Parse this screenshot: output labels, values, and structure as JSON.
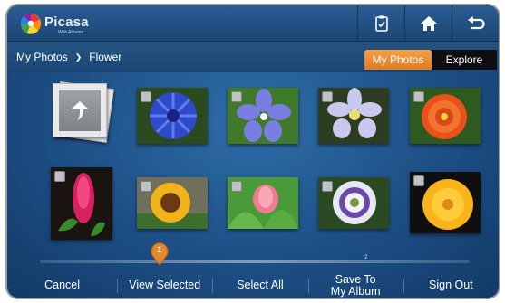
{
  "header": {
    "app_name": "Picasa",
    "app_subtitle": "Web Albums",
    "buttons": [
      {
        "icon": "clipboard-icon"
      },
      {
        "icon": "home-icon"
      },
      {
        "icon": "back-icon"
      }
    ]
  },
  "breadcrumb": {
    "root": "My Photos",
    "separator": "❯",
    "current": "Flower"
  },
  "tabs": {
    "my_photos": "My Photos",
    "explore": "Explore"
  },
  "photos": [
    {
      "subject": "blue cornflower",
      "selected": false
    },
    {
      "subject": "periwinkle flower",
      "selected": false
    },
    {
      "subject": "white anemone",
      "selected": false
    },
    {
      "subject": "orange zinnia",
      "selected": false
    },
    {
      "subject": "red ginger",
      "selected": false
    },
    {
      "subject": "sunflower",
      "selected": false
    },
    {
      "subject": "pink tulip",
      "selected": false
    },
    {
      "subject": "passion flower",
      "selected": false
    },
    {
      "subject": "yellow poppy",
      "selected": false
    }
  ],
  "pager": {
    "current_marker": "1",
    "next_marker": "2"
  },
  "bottom_bar": {
    "cancel": "Cancel",
    "view_selected": "View Selected",
    "select_all": "Select All",
    "save_to_line1": "Save To",
    "save_to_line2": "My Album",
    "sign_out": "Sign Out"
  },
  "colors": {
    "accent_orange": "#e8862c",
    "background_blue": "#1d4f86"
  }
}
